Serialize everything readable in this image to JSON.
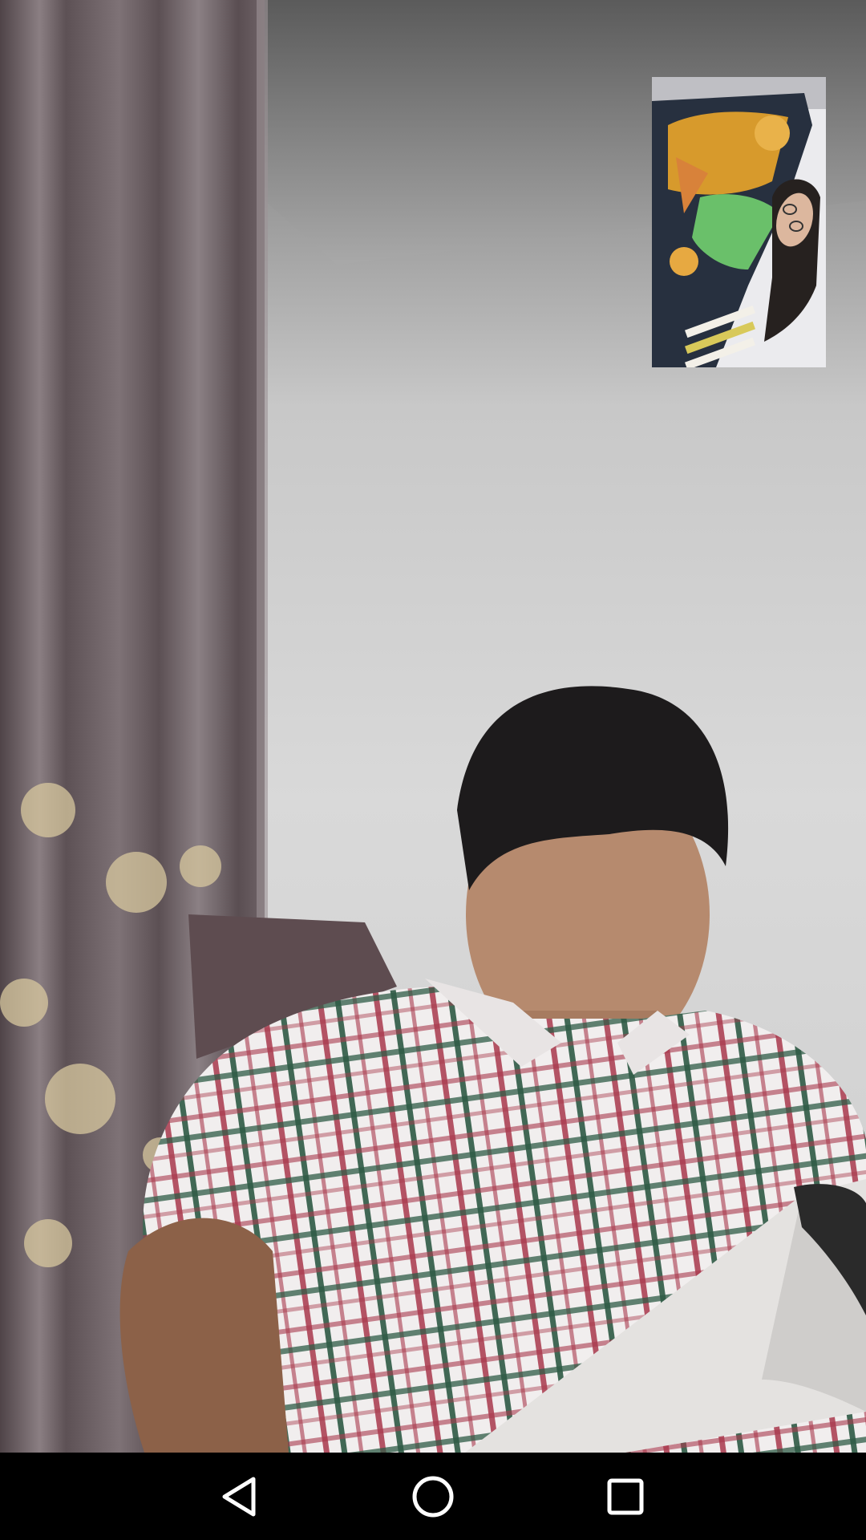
{
  "screen": {
    "type": "video-call",
    "remote_video": {
      "description_icon": "remote-participant-video"
    },
    "local_preview": {
      "description_icon": "self-camera-preview"
    }
  },
  "nav_bar": {
    "back_icon": "triangle-back-icon",
    "home_icon": "circle-home-icon",
    "recents_icon": "square-recents-icon",
    "icon_color": "#ffffff",
    "background": "#000000"
  },
  "colors": {
    "wall": "#d6d6d6",
    "curtain": "#6e6266",
    "shirt_red": "#a3364a",
    "shirt_green": "#2f5a45"
  }
}
